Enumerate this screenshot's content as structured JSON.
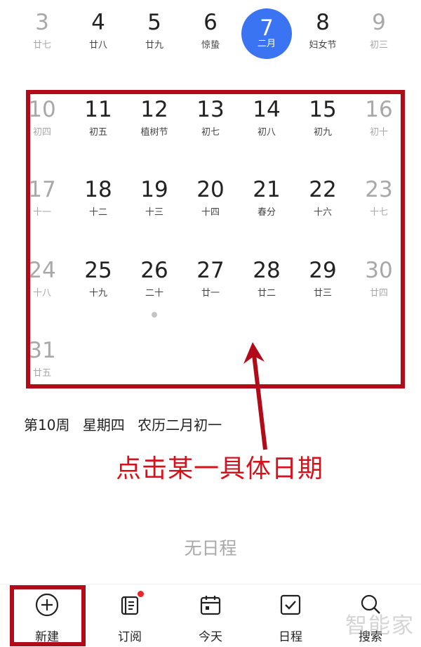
{
  "weeks": [
    [
      {
        "num": "3",
        "sub": "廿七",
        "muted": true
      },
      {
        "num": "4",
        "sub": "廿八"
      },
      {
        "num": "5",
        "sub": "廿九"
      },
      {
        "num": "6",
        "sub": "惊蛰"
      },
      {
        "num": "7",
        "sub": "二月",
        "selected": true
      },
      {
        "num": "8",
        "sub": "妇女节"
      },
      {
        "num": "9",
        "sub": "初三",
        "muted": true
      }
    ],
    [
      {
        "num": "10",
        "sub": "初四",
        "muted": true
      },
      {
        "num": "11",
        "sub": "初五"
      },
      {
        "num": "12",
        "sub": "植树节"
      },
      {
        "num": "13",
        "sub": "初七"
      },
      {
        "num": "14",
        "sub": "初八"
      },
      {
        "num": "15",
        "sub": "初九"
      },
      {
        "num": "16",
        "sub": "初十",
        "muted": true
      }
    ],
    [
      {
        "num": "17",
        "sub": "十一",
        "muted": true
      },
      {
        "num": "18",
        "sub": "十二"
      },
      {
        "num": "19",
        "sub": "十三"
      },
      {
        "num": "20",
        "sub": "十四"
      },
      {
        "num": "21",
        "sub": "春分"
      },
      {
        "num": "22",
        "sub": "十六"
      },
      {
        "num": "23",
        "sub": "十七",
        "muted": true
      }
    ],
    [
      {
        "num": "24",
        "sub": "十八",
        "muted": true
      },
      {
        "num": "25",
        "sub": "十九"
      },
      {
        "num": "26",
        "sub": "二十",
        "dot": true
      },
      {
        "num": "27",
        "sub": "廿一"
      },
      {
        "num": "28",
        "sub": "廿二"
      },
      {
        "num": "29",
        "sub": "廿三"
      },
      {
        "num": "30",
        "sub": "廿四",
        "muted": true
      }
    ],
    [
      {
        "num": "31",
        "sub": "廿五",
        "muted": true
      }
    ]
  ],
  "info": {
    "week": "第10周",
    "weekday": "星期四",
    "lunar": "农历二月初一"
  },
  "annotation": "点击某一具体日期",
  "empty_text": "无日程",
  "tabs": [
    {
      "label": "新建",
      "icon": "plus-circle-icon"
    },
    {
      "label": "订阅",
      "icon": "subscribe-list-icon"
    },
    {
      "label": "今天",
      "icon": "calendar-today-icon"
    },
    {
      "label": "日程",
      "icon": "schedule-check-icon"
    },
    {
      "label": "搜索",
      "icon": "search-icon"
    }
  ],
  "watermark": "智能家",
  "colors": {
    "accent": "#3b74f2",
    "annotation_red": "#d6111c",
    "highlight_border": "#b10b1a",
    "badge": "#e8262b"
  }
}
